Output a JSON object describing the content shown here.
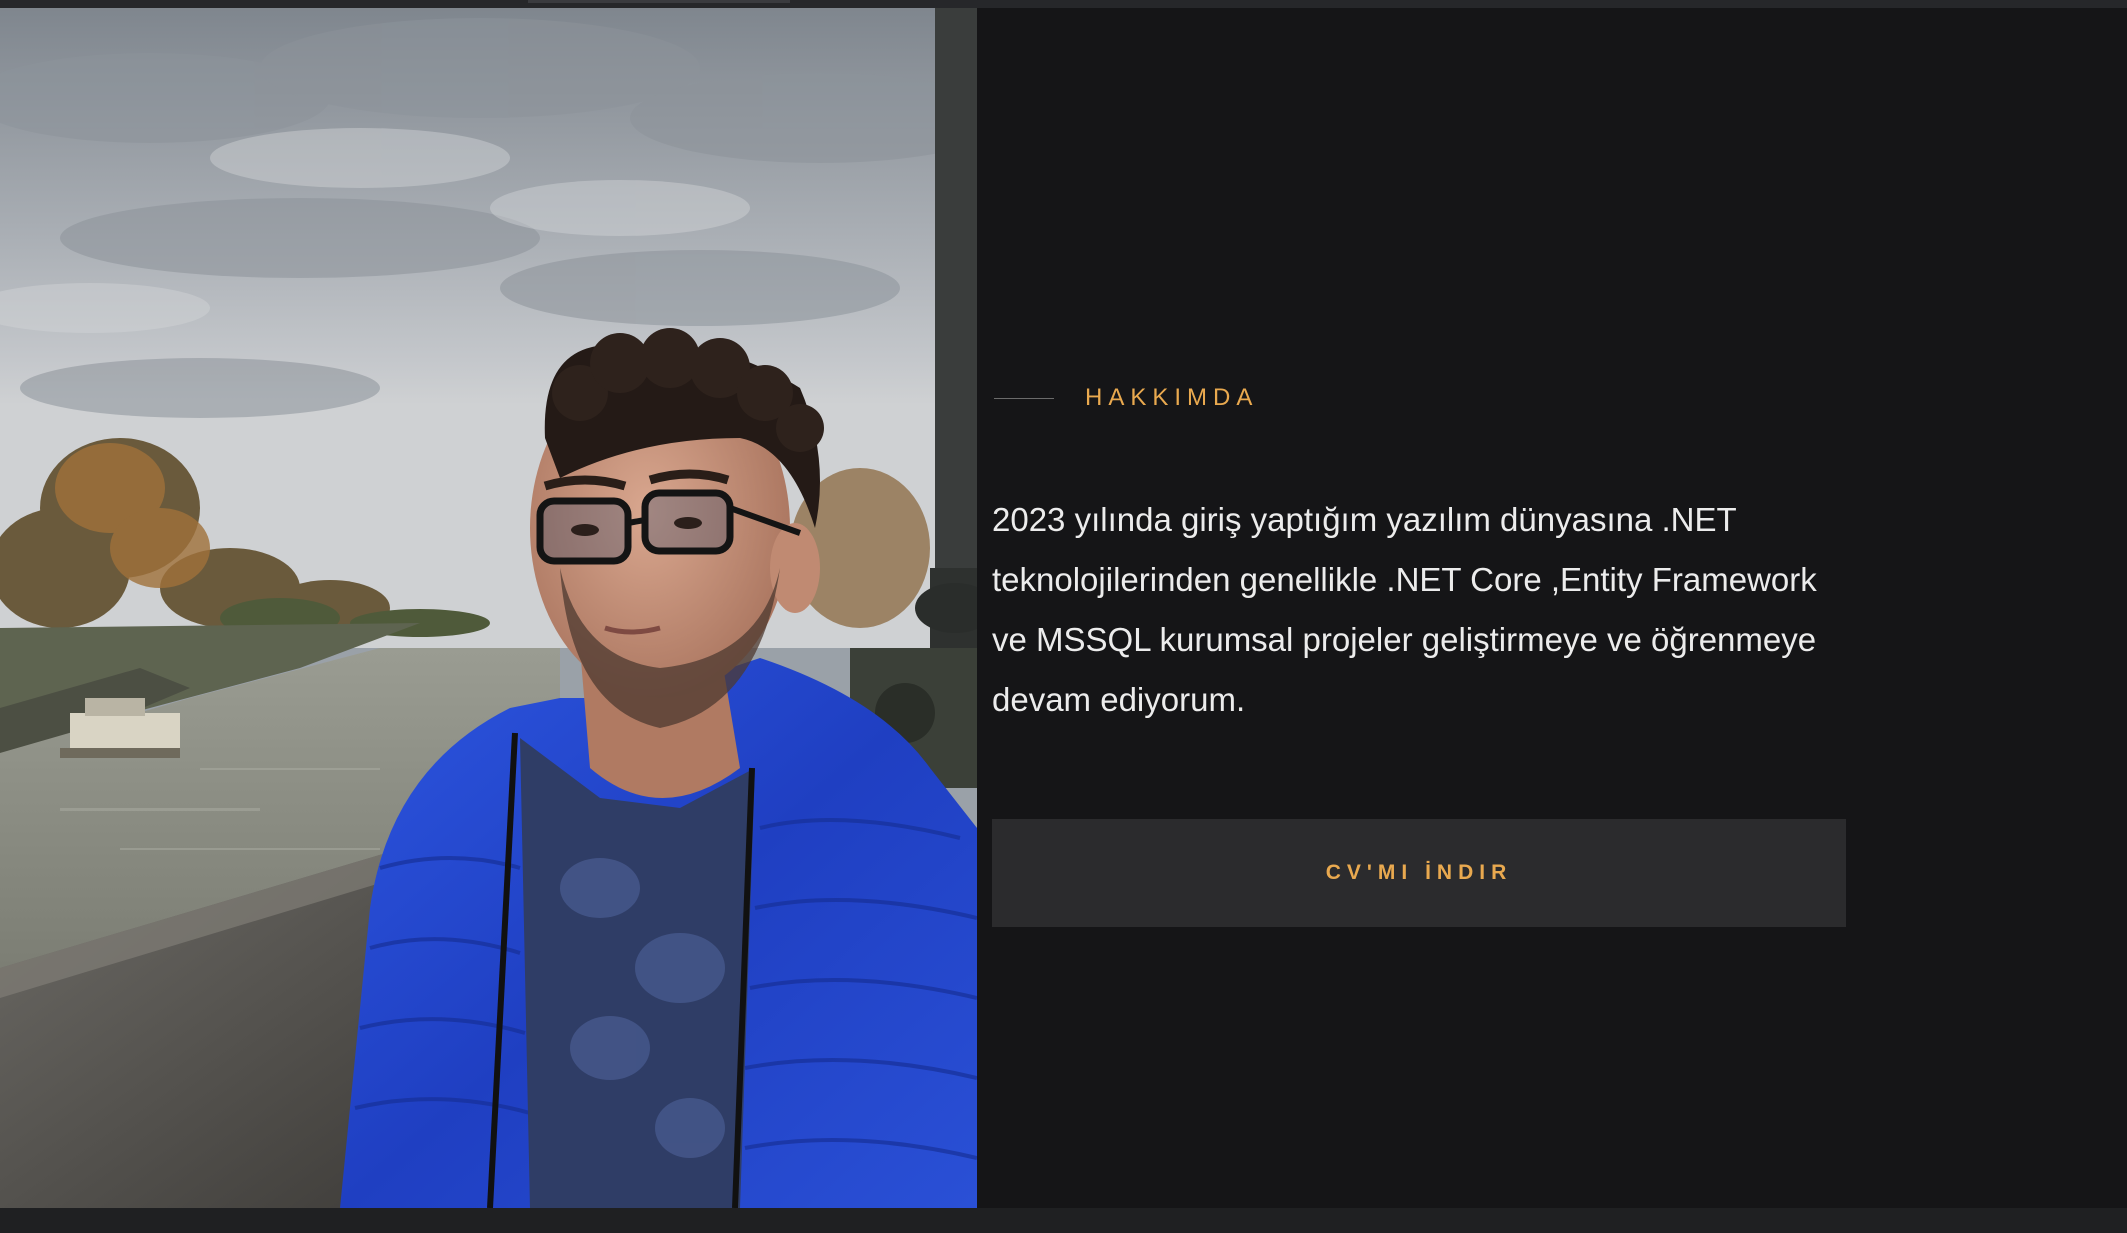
{
  "about": {
    "eyebrow": "HAKKIMDA",
    "bio": "2023 yılında giriş yaptığım yazılım dünyasına .NET teknolojilerinden genellikle .NET Core ,Entity Framework ve MSSQL kurumsal projeler geliştirmeye ve öğrenmeye devam ediyorum.",
    "cv_button_label": "CV'MI İNDIR"
  },
  "colors": {
    "background": "#151517",
    "accent": "#e9a94f",
    "text": "#ececec",
    "button_bg": "#2b2b2d"
  },
  "icons": {
    "photo": "profile-photo"
  }
}
